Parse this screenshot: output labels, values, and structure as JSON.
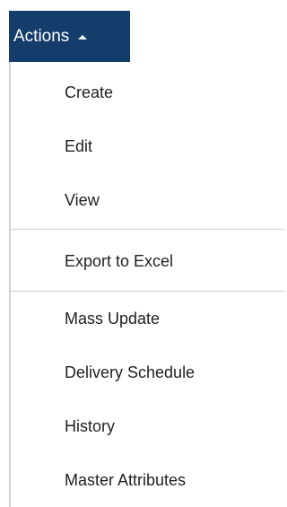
{
  "actions_button": {
    "label": "Actions",
    "icon": "caret-up-icon"
  },
  "menu": {
    "groups": [
      {
        "items": [
          {
            "label": "Create"
          },
          {
            "label": "Edit"
          },
          {
            "label": "View"
          }
        ]
      },
      {
        "items": [
          {
            "label": "Export to Excel"
          }
        ]
      },
      {
        "items": [
          {
            "label": "Mass Update"
          },
          {
            "label": "Delivery Schedule"
          },
          {
            "label": "History"
          },
          {
            "label": "Master Attributes"
          }
        ]
      }
    ]
  },
  "colors": {
    "button_bg": "#143d6b",
    "button_text": "#ffffff",
    "item_text": "#1f1f1f",
    "divider": "#cfcfcf",
    "menu_border": "#d2d2d2"
  }
}
